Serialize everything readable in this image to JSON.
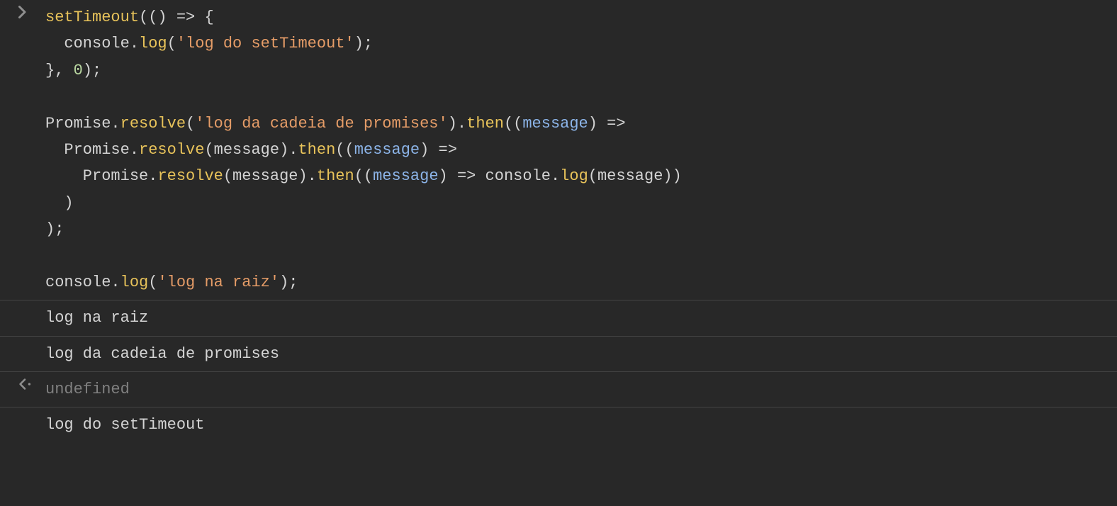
{
  "input": {
    "line1": {
      "t1": "setTimeout",
      "t2": "(() ",
      "t3": "=>",
      "t4": " {"
    },
    "line2": {
      "t1": "  console.",
      "t2": "log",
      "t3": "(",
      "t4": "'log do setTimeout'",
      "t5": ");"
    },
    "line3": {
      "t1": "}, ",
      "t2": "0",
      "t3": ");"
    },
    "line4": "",
    "line5": {
      "t1": "Promise.",
      "t2": "resolve",
      "t3": "(",
      "t4": "'log da cadeia de promises'",
      "t5": ").",
      "t6": "then",
      "t7": "((",
      "t8": "message",
      "t9": ") ",
      "t10": "=>"
    },
    "line6": {
      "t1": "  Promise.",
      "t2": "resolve",
      "t3": "(message).",
      "t4": "then",
      "t5": "((",
      "t6": "message",
      "t7": ") ",
      "t8": "=>"
    },
    "line7": {
      "t1": "    Promise.",
      "t2": "resolve",
      "t3": "(message).",
      "t4": "then",
      "t5": "((",
      "t6": "message",
      "t7": ") ",
      "t8": "=>",
      "t9": " console.",
      "t10": "log",
      "t11": "(message))"
    },
    "line8": {
      "t1": "  )"
    },
    "line9": {
      "t1": ");"
    },
    "line10": "",
    "line11": {
      "t1": "console.",
      "t2": "log",
      "t3": "(",
      "t4": "'log na raiz'",
      "t5": ");"
    }
  },
  "output": {
    "log1": "log na raiz",
    "log2": "log da cadeia de promises",
    "return": "undefined",
    "log3": "log do setTimeout"
  }
}
